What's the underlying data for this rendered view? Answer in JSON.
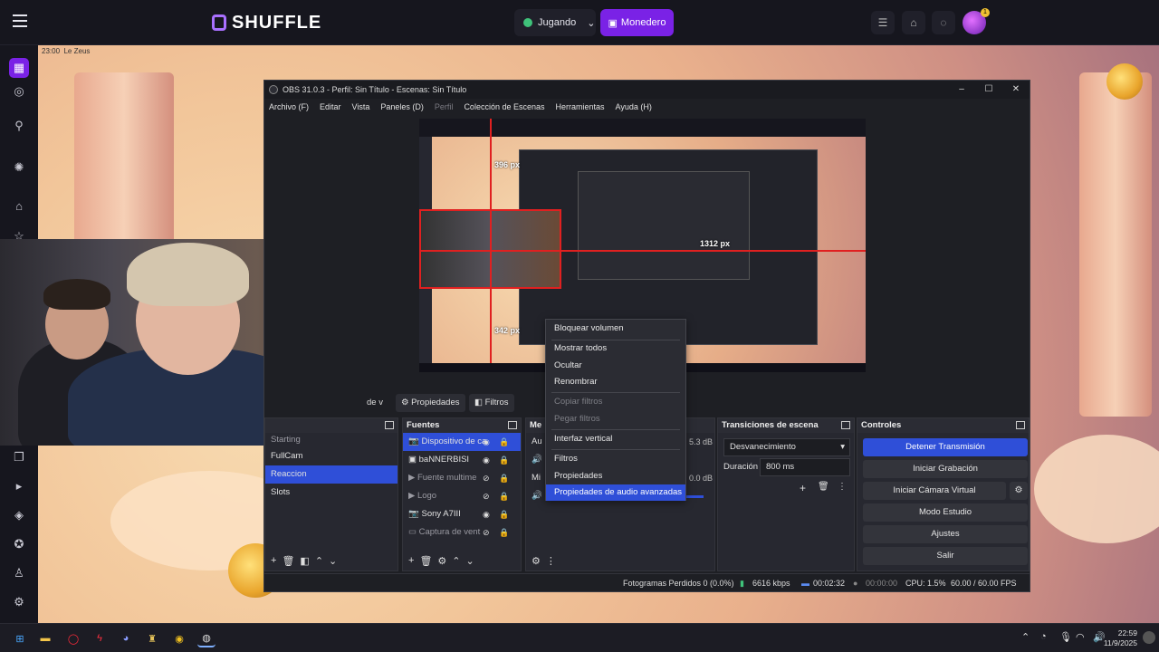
{
  "site": {
    "logo_text": "SHUFFLE",
    "jugando_label": "Jugando",
    "monedero_label": "Monedero",
    "avatar_badge": "1",
    "game_time": "23:00",
    "game_name": "Le Zeus"
  },
  "obs": {
    "title": "OBS 31.0.3 - Perfil: Sin Título - Escenas: Sin Título",
    "menu": [
      "Archivo (F)",
      "Editar",
      "Vista",
      "Paneles (D)",
      "Perfil",
      "Colección de Escenas",
      "Herramientas",
      "Ayuda (H)"
    ],
    "preview_labels": {
      "width_a": "396 px",
      "width_b": "1312 px",
      "height_a": "342 px"
    },
    "toolbar": {
      "partial": "de v",
      "properties": "Propiedades",
      "filters": "Filtros"
    },
    "scenes": [
      "Starting",
      "FullCam",
      "Reaccion",
      "Slots"
    ],
    "sources_title": "Fuentes",
    "sources": [
      "Dispositivo de ca",
      "baNNERBISI",
      "Fuente multime",
      "Logo",
      "Sony A7III",
      "Captura de vent"
    ],
    "mixer": {
      "title_partial": "Me",
      "db1": "5.3 dB",
      "db2": "0.0 dB",
      "row_a": "Au",
      "row_b": "Mi"
    },
    "transitions": {
      "title": "Transiciones de escena",
      "selected": "Desvanecimiento",
      "duration_label": "Duración",
      "duration_value": "800 ms"
    },
    "controls": {
      "title": "Controles",
      "buttons": [
        "Detener Transmisión",
        "Iniciar Grabación",
        "Iniciar Cámara Virtual",
        "Modo Estudio",
        "Ajustes",
        "Salir"
      ]
    },
    "status": {
      "dropped": "Fotogramas Perdidos 0 (0.0%)",
      "bitrate": "6616 kbps",
      "stream_time": "00:02:32",
      "rec_time": "00:00:00",
      "cpu": "CPU: 1.5%",
      "fps": "60.00 / 60.00 FPS"
    }
  },
  "context_menu": {
    "items": [
      {
        "label": "Bloquear volumen",
        "state": "normal"
      },
      {
        "label": "Mostrar todos",
        "state": "normal"
      },
      {
        "label": "Ocultar",
        "state": "normal"
      },
      {
        "label": "Renombrar",
        "state": "normal"
      },
      {
        "label": "Copiar filtros",
        "state": "disabled"
      },
      {
        "label": "Pegar filtros",
        "state": "disabled"
      },
      {
        "label": "Interfaz vertical",
        "state": "normal"
      },
      {
        "label": "Filtros",
        "state": "normal"
      },
      {
        "label": "Propiedades",
        "state": "normal"
      },
      {
        "label": "Propiedades de audio avanzadas",
        "state": "highlighted"
      }
    ]
  },
  "taskbar": {
    "time": "22:59",
    "date": "11/9/2025"
  },
  "colors": {
    "accent": "#7a22e6",
    "obs_select": "#2f4fd8",
    "bg": "#16161e"
  }
}
